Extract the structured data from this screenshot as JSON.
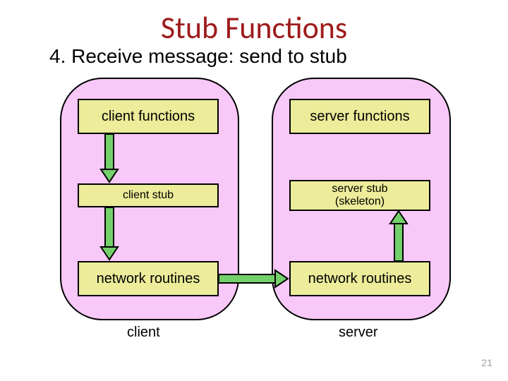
{
  "title": "Stub Functions",
  "subtitle": "4. Receive message: send to stub",
  "client": {
    "top": "client functions",
    "mid": "client stub",
    "bot": "network routines",
    "label": "client"
  },
  "server": {
    "top": "server functions",
    "mid": "server stub\n(skeleton)",
    "bot": "network routines",
    "label": "server"
  },
  "page": "21"
}
